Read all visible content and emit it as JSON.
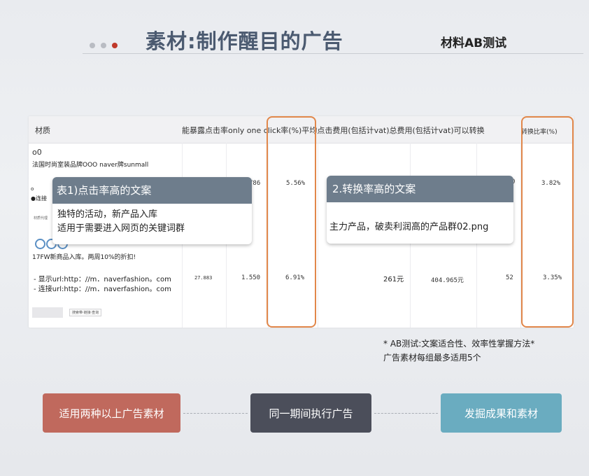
{
  "header": {
    "title": "素材:制作醒目的广告",
    "subtitle": "材料AB测试"
  },
  "table": {
    "columns": [
      "材质",
      "能暴露点击率only one click率(%)平均点击费用(包括计vat)总费用(包括计vat)可以转换",
      "转换比率(%)"
    ],
    "row1": {
      "ad_prefix": "o0",
      "ad_title": "法国时尚室装品牌OOO naver牌sunmall",
      "partial_lines": [
        "o",
        "●连接",
        "材质代理"
      ],
      "clicks": "786",
      "ctr": "5.56%",
      "conversions_partial": "0",
      "conversion_rate": "3.82%"
    },
    "row2": {
      "ad_title": "17FW新商品入库。两周10%的折扣!",
      "display_url": "- 显示url:http：//m．naverfashion。com",
      "link_url": "- 连接url:http：//m．naverfashion。com",
      "button": "搜索带·链接·查询",
      "impressions": "27.883",
      "clicks": "1.550",
      "ctr": "6.91%",
      "avg_cpc": "261元",
      "total_cost": "404.965元",
      "conversions": "52",
      "conversion_rate": "3.35%"
    }
  },
  "callout1": {
    "title": "表1)点击率高的文案",
    "line1": "独特的活动，新产品入库",
    "line2": "适用于需要进入网页的关键词群"
  },
  "callout2": {
    "title": "2.转换率高的文案",
    "body": "主力产品，破卖利润高的产品群02.png"
  },
  "note": {
    "line1": "* AB测试:文案适合性、效率性掌握方法*",
    "line2": "广告素材每组最多适用5个"
  },
  "steps": [
    {
      "label": "适用两种以上广告素材",
      "color": "#c0695d"
    },
    {
      "label": "同一期间执行广告",
      "color": "#4b4e5a"
    },
    {
      "label": "发掘成果和素材",
      "color": "#6aacc0"
    }
  ],
  "colors": {
    "title": "#4b5a70",
    "highlight_border": "#e1874a",
    "callout_header": "#6e7d8c",
    "active_dot": "#c0392b"
  }
}
